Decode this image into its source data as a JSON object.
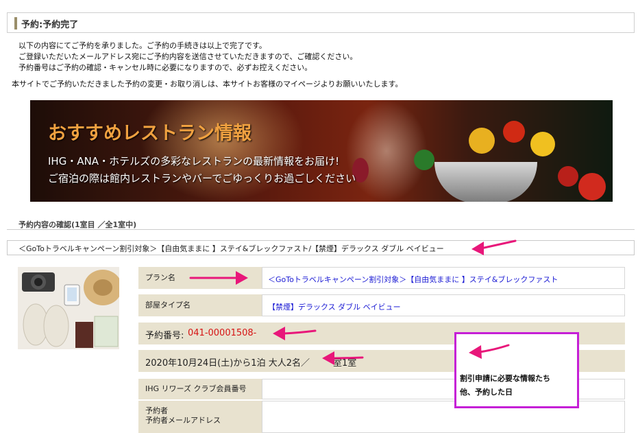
{
  "header": {
    "title": "予約:予約完了"
  },
  "messages": [
    "以下の内容にてご予約を承りました。ご予約の手続きは以上で完了です。",
    "ご登録いただいたメールアドレス宛にご予約内容を送信させていただきますので、ご確認ください。",
    "予約番号はご予約の確認・キャンセル時に必要になりますので、必ずお控えください。"
  ],
  "notice": "本サイトでご予約いただきました予約の変更・お取り消しは、本サイトお客様のマイページよりお願いいたします。",
  "banner": {
    "title": "おすすめレストラン情報",
    "line1": "IHG・ANA・ホテルズの多彩なレストランの最新情報をお届け!",
    "line2": "ご宿泊の際は館内レストランやバーでごゆっくりお過ごしください"
  },
  "section": {
    "label": "予約内容の確認(1室目 ／全1室中)"
  },
  "plan_header": "＜GoToトラベルキャンペーン割引対象＞【自由気ままに 】ステイ&ブレックファスト/【禁煙】デラックス ダブル ベイビュー",
  "details": {
    "plan_label": "プラン名",
    "plan_value": "＜GoToトラベルキャンペーン割引対象＞【自由気ままに 】ステイ&ブレックファスト",
    "room_label": "部屋タイプ名",
    "room_value": "【禁煙】デラックス ダブル ベイビュー",
    "reservation_label": "予約番号:",
    "reservation_number": "041-00001508-",
    "stay_info": "2020年10月24日(土)から1泊 大人2名／",
    "stay_info_tail": "室1室",
    "ihg_label": "IHG リワーズ クラブ会員番号",
    "booker_label": "予約者",
    "booker_email_label": "予約者メールアドレス"
  },
  "annotation": {
    "line1": "割引申請に必要な情報たち",
    "line2": "他、予約した日"
  },
  "colors": {
    "annotation_border": "#c51fd6",
    "arrow": "#e8177a",
    "link": "#1a1ad4",
    "reservation_number": "#d61414",
    "label_bg": "#e8e2cf",
    "banner_title": "#f0a140"
  }
}
